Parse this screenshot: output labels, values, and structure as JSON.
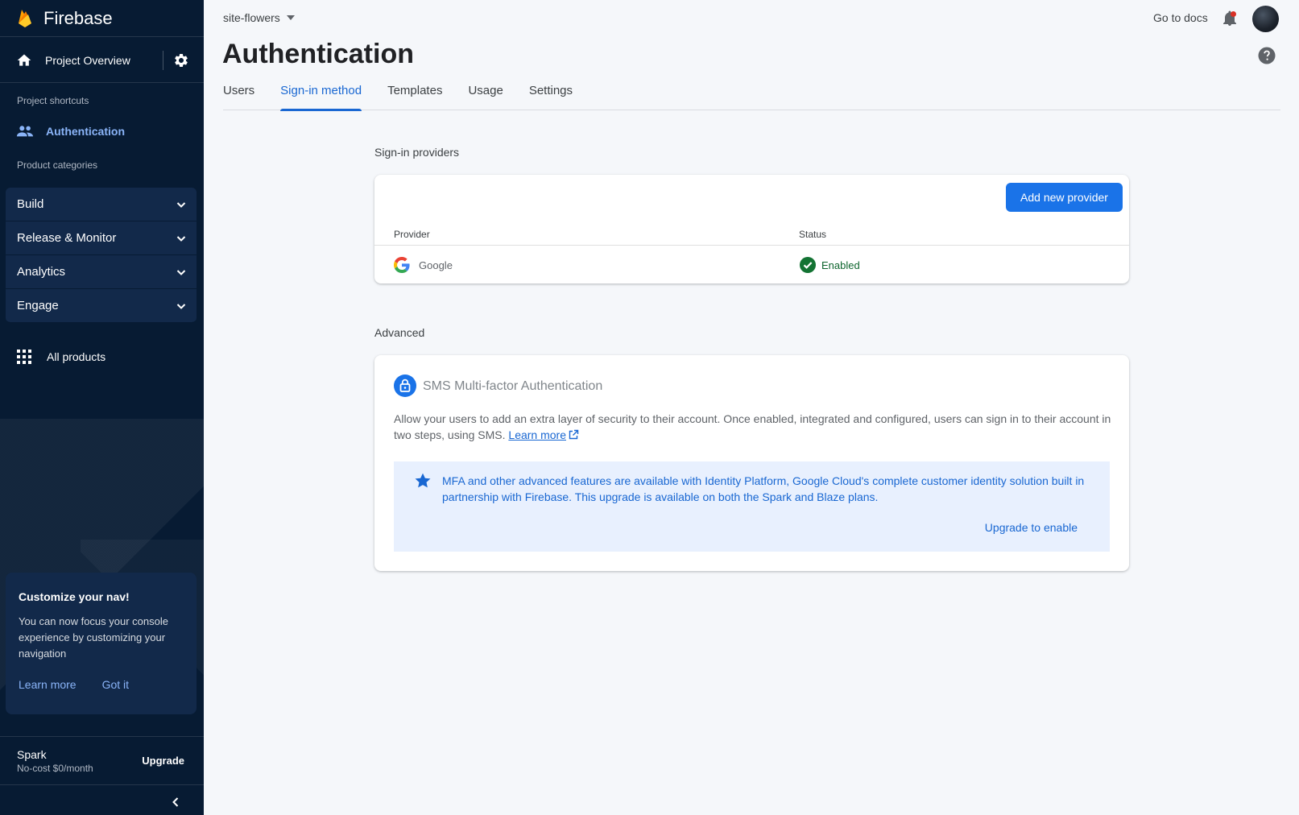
{
  "sidebar": {
    "brand": "Firebase",
    "project_overview": "Project Overview",
    "shortcuts_label": "Project shortcuts",
    "shortcut_item": "Authentication",
    "categories_label": "Product categories",
    "categories": [
      "Build",
      "Release & Monitor",
      "Analytics",
      "Engage"
    ],
    "all_products": "All products",
    "customize": {
      "title": "Customize your nav!",
      "body": "You can now focus your console experience by customizing your navigation",
      "learn_more": "Learn more",
      "got_it": "Got it"
    },
    "plan": {
      "name": "Spark",
      "cost": "No-cost $0/month",
      "upgrade": "Upgrade"
    }
  },
  "topbar": {
    "project": "site-flowers",
    "go_to_docs": "Go to docs"
  },
  "page": {
    "title": "Authentication",
    "tabs": [
      "Users",
      "Sign-in method",
      "Templates",
      "Usage",
      "Settings"
    ],
    "active_tab": "Sign-in method"
  },
  "providers": {
    "heading": "Sign-in providers",
    "add_button": "Add new provider",
    "columns": [
      "Provider",
      "Status"
    ],
    "rows": [
      {
        "provider": "Google",
        "status": "Enabled"
      }
    ]
  },
  "advanced": {
    "heading": "Advanced",
    "mfa_title": "SMS Multi-factor Authentication",
    "mfa_desc": "Allow your users to add an extra layer of security to their account. Once enabled, integrated and configured, users can sign in to their account in two steps, using SMS.",
    "learn_more": "Learn more",
    "promo_text": "MFA and other advanced features are available with Identity Platform, Google Cloud's complete customer identity solution built in partnership with Firebase. This upgrade is available on both the Spark and Blaze plans.",
    "upgrade_link": "Upgrade to enable"
  },
  "colors": {
    "sidebar_bg": "#071b33",
    "accent": "#1a73e8",
    "enabled_green": "#188038"
  }
}
